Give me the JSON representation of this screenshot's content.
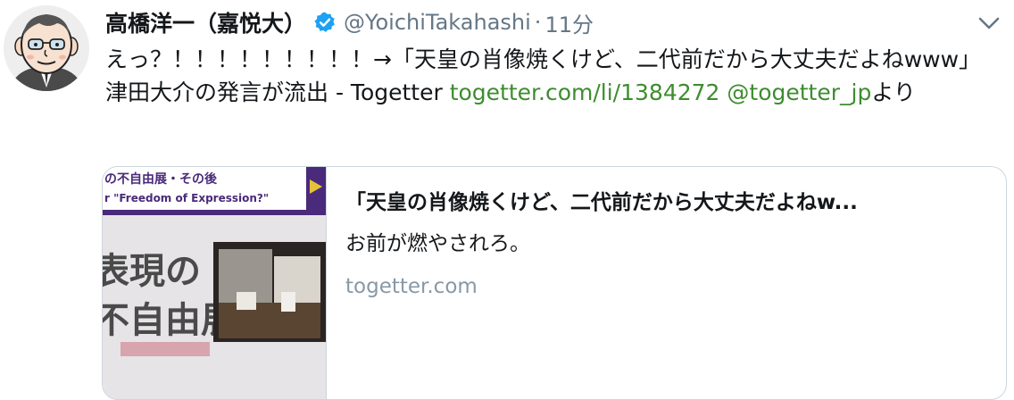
{
  "tweet": {
    "display_name": "高橋洋一（嘉悦大）",
    "handle": "@YoichiTakahashi",
    "separator": "·",
    "time": "11分",
    "text_main": "えっ？！！！！！！！！！→「天皇の肖像焼くけど、二代前だから大丈夫だよねwww」津田大介の発言が流出 - Togetter ",
    "link_url": "togetter.com/li/1384272",
    "text_space": " ",
    "link_mention": "@togetter_jp",
    "text_tail": "より"
  },
  "card": {
    "thumb_banner_line1": "の不自由展・その後",
    "thumb_banner_line2": "r \"Freedom of Expression?\"",
    "thumb_big_line1": "表現の",
    "thumb_big_line2": "不自由展",
    "title": "「天皇の肖像焼くけど、二代前だから大丈夫だよねw...",
    "description": "お前が燃やされろ。",
    "domain": "togetter.com"
  },
  "colors": {
    "verified": "#1da1f2",
    "link": "#3d8d2e",
    "secondary": "#657786",
    "banner": "#4a2a7a"
  },
  "icons": {
    "avatar": "cartoon-face-avatar",
    "verified": "verified-badge-icon",
    "caret": "chevron-down-icon"
  }
}
